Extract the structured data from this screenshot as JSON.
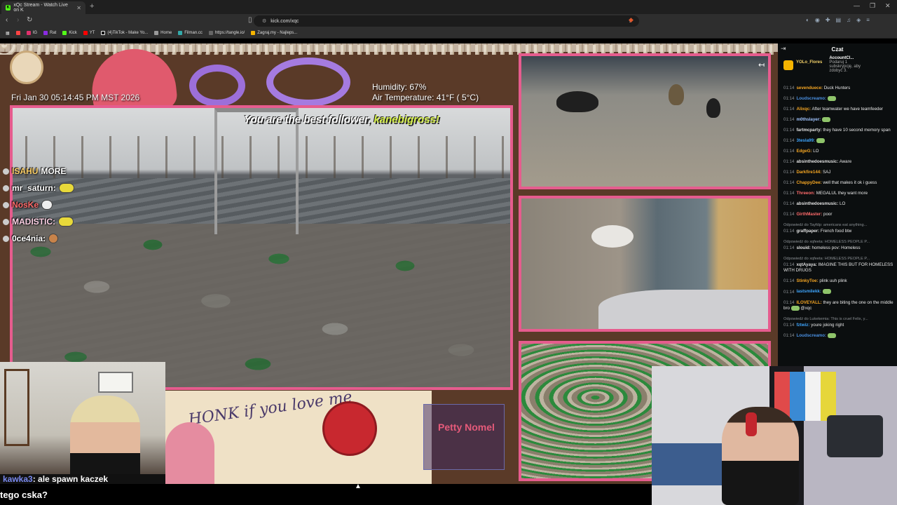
{
  "browser": {
    "tab_title": "xQc Stream - Watch Live on K",
    "url": "kick.com/xqc",
    "bookmarks": [
      "IG",
      "Rat",
      "Kick",
      "YT",
      "(4)TikTok - Make Yo...",
      "Home",
      "Filman.cc",
      "https://tangle.io/",
      "Zagraj.my - Najleps..."
    ]
  },
  "stream": {
    "datetime": "Fri Jan 30 05:14:45 PM MST 2026",
    "humidity": "Humidity: 67%",
    "air_temperature": "Air Temperature: 41°F ( 5°C)",
    "follower_prefix": "You are the best follower, ",
    "follower_name": "kanebigross!",
    "overlay_chat": [
      {
        "name": "ISAHU",
        "text": "MORE"
      },
      {
        "name": "mr_saturn:",
        "text": ""
      },
      {
        "name": "NosKe",
        "text": ""
      },
      {
        "name": "MADISTIC:",
        "text": ""
      },
      {
        "name": "0ce4nia:",
        "text": ""
      }
    ],
    "note_text": "HONK if you love me",
    "petty_text": "Petty Nomel",
    "bottom_chat_name": "kawka3",
    "bottom_chat_text": ": ale spawn kaczek",
    "bottom_chat_2": "tego cska?"
  },
  "chat": {
    "title": "Czat",
    "pinned": {
      "user": "YOLo_Flores",
      "account": "AccountCl...",
      "line1": "Podaruj 1",
      "line2": "subskrypcję, aby",
      "line3": "zdobyć 3."
    },
    "messages": [
      {
        "time": "01:14",
        "user": "sevenduece:",
        "color": "#f5a623",
        "text": "Duck Hunters",
        "reply": ""
      },
      {
        "time": "01:14",
        "user": "Loudscreamo:",
        "color": "#4a90e2",
        "text": "",
        "reply": ""
      },
      {
        "time": "01:14",
        "user": "Alixqc:",
        "color": "#f5a623",
        "text": "After teamwater we have teamfeeder",
        "reply": ""
      },
      {
        "time": "01:14",
        "user": "m0thslayer:",
        "color": "#a0c4ff",
        "text": "",
        "reply": ""
      },
      {
        "time": "01:14",
        "user": "fartmcparty:",
        "color": "#e0e0e0",
        "text": "they have 10 second memory span",
        "reply": ""
      },
      {
        "time": "01:14",
        "user": "3tesla99:",
        "color": "#3ea6ff",
        "text": "",
        "reply": ""
      },
      {
        "time": "01:14",
        "user": "EdgeG:",
        "color": "#f5a623",
        "text": "LO",
        "reply": ""
      },
      {
        "time": "01:14",
        "user": "absinthedoesmusic:",
        "color": "#e0e0e0",
        "text": "Aware",
        "reply": ""
      },
      {
        "time": "01:14",
        "user": "Darkfire144:",
        "color": "#f5a623",
        "text": "SAJ",
        "reply": ""
      },
      {
        "time": "01:14",
        "user": "ChappyDee:",
        "color": "#f5a623",
        "text": "well that makes it ok i guess",
        "reply": ""
      },
      {
        "time": "01:14",
        "user": "Threeon:",
        "color": "#ff6b6b",
        "text": "MEGALUL they want more",
        "reply": ""
      },
      {
        "time": "01:14",
        "user": "absinthedoesmusic:",
        "color": "#e0e0e0",
        "text": "LO",
        "reply": ""
      },
      {
        "time": "01:14",
        "user": "GirthMaster:",
        "color": "#ff6b6b",
        "text": "poor",
        "reply": ""
      },
      {
        "time": "01:14",
        "user": "graffpaper:",
        "color": "#e0e0e0",
        "text": "French food btw",
        "reply": "Odpowiedź do Tayfdp: americans eat anything..."
      },
      {
        "time": "01:14",
        "user": "slouid:",
        "color": "#e0e0e0",
        "text": "homeless pov: Homeless",
        "reply": "Odpowiedź do xqfeeta: HOMELESS PEOPLE P..."
      },
      {
        "time": "01:14",
        "user": "xqtAyaya:",
        "color": "#e0e0e0",
        "text": "IMAGINE THIS BUT FOR HOMELESS WITH DRUGS",
        "reply": "Odpowiedź do xqfeeta: HOMELESS PEOPLE P..."
      },
      {
        "time": "01:14",
        "user": "StinkyToe:",
        "color": "#f5a623",
        "text": "plink uuh plink",
        "reply": ""
      },
      {
        "time": "01:14",
        "user": "lastsmilekk:",
        "color": "#3ea6ff",
        "text": "",
        "reply": ""
      },
      {
        "time": "01:14",
        "user": "ILOVEYALL:",
        "color": "#f5a623",
        "text": "they are biting the one on the middle bro",
        "text2": "@xqc",
        "reply": ""
      },
      {
        "time": "01:14",
        "user": "fztwiz:",
        "color": "#3ea6ff",
        "text": "youre joking right",
        "reply": "Odpowiedź do Lukekemia: This is cruel Felix, y..."
      },
      {
        "time": "01:14",
        "user": "Loudscreamo:",
        "color": "#4a90e2",
        "text": "",
        "reply": ""
      }
    ]
  },
  "colors": {
    "frame_pink": "#e65c8e",
    "kick_green": "#53fc18"
  }
}
